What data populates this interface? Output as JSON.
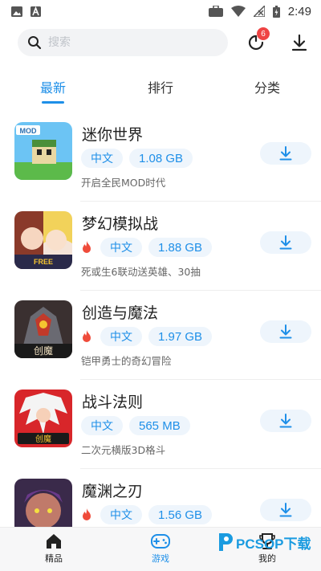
{
  "status_bar": {
    "time": "2:49",
    "left_icons": [
      "image-icon",
      "a-icon"
    ],
    "right_icons": [
      "briefcase-icon",
      "wifi-icon",
      "signal-off-icon",
      "battery-charging-icon"
    ]
  },
  "header": {
    "search_placeholder": "搜索",
    "download_badge_count": "6"
  },
  "tabs": [
    {
      "label": "最新",
      "active": true
    },
    {
      "label": "排行",
      "active": false
    },
    {
      "label": "分类",
      "active": false
    }
  ],
  "apps": [
    {
      "name": "迷你世界",
      "hot": false,
      "lang": "中文",
      "size": "1.08 GB",
      "desc": "开启全民MOD时代"
    },
    {
      "name": "梦幻模拟战",
      "hot": true,
      "lang": "中文",
      "size": "1.88 GB",
      "desc": "死或生6联动送英雄、30抽"
    },
    {
      "name": "创造与魔法",
      "hot": true,
      "lang": "中文",
      "size": "1.97 GB",
      "desc": "铠甲勇士的奇幻冒险"
    },
    {
      "name": "战斗法则",
      "hot": false,
      "lang": "中文",
      "size": "565 MB",
      "desc": "二次元横版3D格斗"
    },
    {
      "name": "魔渊之刃",
      "hot": true,
      "lang": "中文",
      "size": "1.56 GB",
      "desc": ""
    }
  ],
  "bottom_nav": [
    {
      "label": "精品",
      "icon": "home-icon",
      "active": false
    },
    {
      "label": "游戏",
      "icon": "gamepad-icon",
      "active": true
    },
    {
      "label": "我的",
      "icon": "trophy-icon",
      "active": false
    }
  ],
  "watermark": {
    "text": "PCSOP下载"
  },
  "colors": {
    "accent": "#1e8fe8",
    "tag_bg": "#eef5fc",
    "badge": "#ef4444",
    "hot": "#ef4b3a"
  }
}
